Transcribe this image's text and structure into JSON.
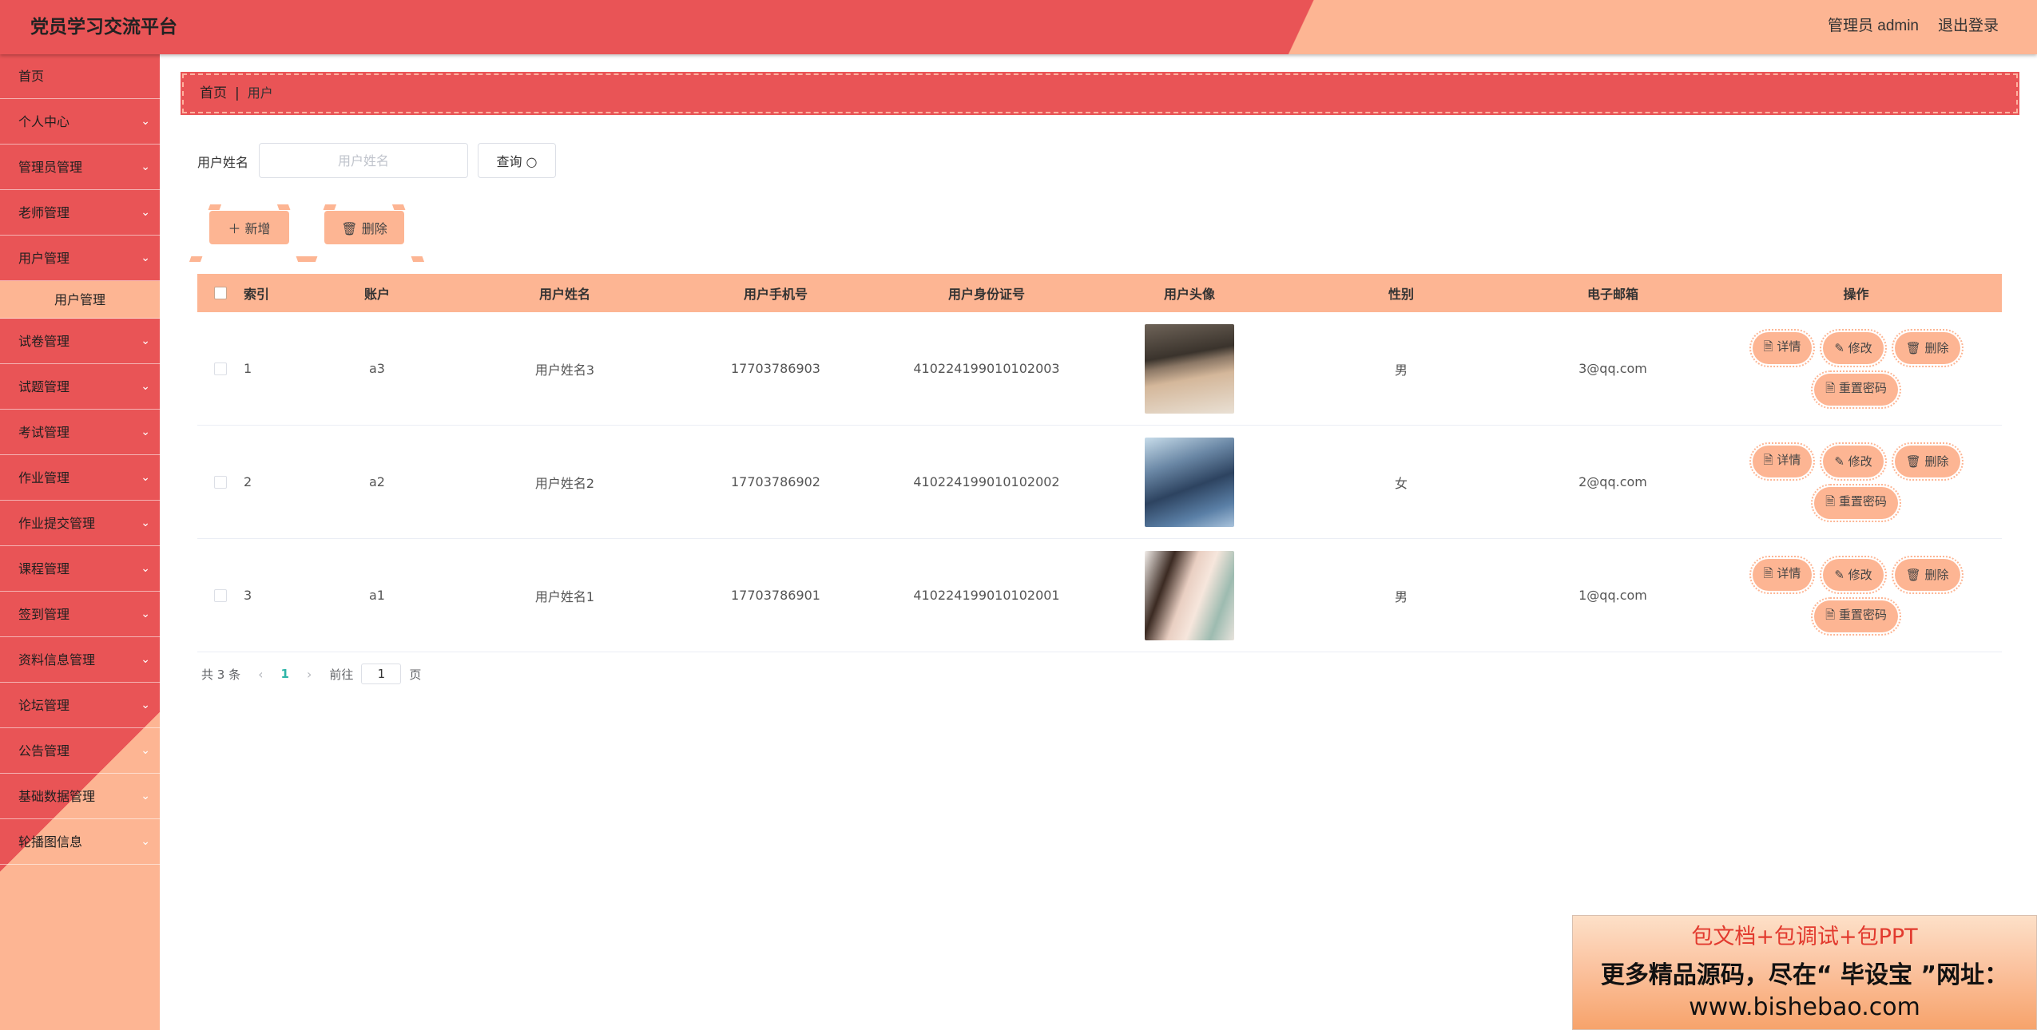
{
  "app": {
    "title": "党员学习交流平台",
    "user_label": "管理员 admin",
    "logout_label": "退出登录"
  },
  "sidebar": {
    "home": "首页",
    "items": [
      {
        "label": "个人中心"
      },
      {
        "label": "管理员管理"
      },
      {
        "label": "老师管理"
      },
      {
        "label": "用户管理"
      },
      {
        "label": "试卷管理"
      },
      {
        "label": "试题管理"
      },
      {
        "label": "考试管理"
      },
      {
        "label": "作业管理"
      },
      {
        "label": "作业提交管理"
      },
      {
        "label": "课程管理"
      },
      {
        "label": "签到管理"
      },
      {
        "label": "资料信息管理"
      },
      {
        "label": "论坛管理"
      },
      {
        "label": "公告管理"
      },
      {
        "label": "基础数据管理"
      },
      {
        "label": "轮播图信息"
      }
    ],
    "sub_item": "用户管理",
    "chevron": "chevron-down-icon"
  },
  "breadcrumb": {
    "home": "首页",
    "sep": "|",
    "current": "用户"
  },
  "search": {
    "label": "用户姓名",
    "placeholder": "用户姓名",
    "value": "",
    "button_label": "查询 ○"
  },
  "actions": {
    "add_label": "＋ 新增",
    "delete_label": "🗑 删除"
  },
  "table": {
    "headers": [
      "索引",
      "账户",
      "用户姓名",
      "用户手机号",
      "用户身份证号",
      "用户头像",
      "性别",
      "电子邮箱",
      "操作"
    ],
    "rows": [
      {
        "index": "1",
        "account": "a3",
        "name": "用户姓名3",
        "phone": "17703786903",
        "id_no": "410224199010102003",
        "gender": "男",
        "email": "3@qq.com"
      },
      {
        "index": "2",
        "account": "a2",
        "name": "用户姓名2",
        "phone": "17703786902",
        "id_no": "410224199010102002",
        "gender": "女",
        "email": "2@qq.com"
      },
      {
        "index": "3",
        "account": "a1",
        "name": "用户姓名1",
        "phone": "17703786901",
        "id_no": "410224199010102001",
        "gender": "男",
        "email": "1@qq.com"
      }
    ],
    "ops": {
      "detail": "🗎 详情",
      "edit": "✎ 修改",
      "delete": "🗑 删除",
      "reset": "🗎 重置密码"
    }
  },
  "pagination": {
    "total": "共 3 条",
    "prev": "‹",
    "current": "1",
    "next": "›",
    "goto_prefix": "前往",
    "goto_value": "1",
    "goto_suffix": "页"
  },
  "watermark": {
    "line1": "包文档+包调试+包PPT",
    "line2": "更多精品源码，尽在“ 毕设宝 ”网址：",
    "line3": "www.bishebao.com"
  },
  "colors": {
    "primary": "#e95456",
    "accent": "#fdb593",
    "pager_active": "#2fb5a8"
  }
}
